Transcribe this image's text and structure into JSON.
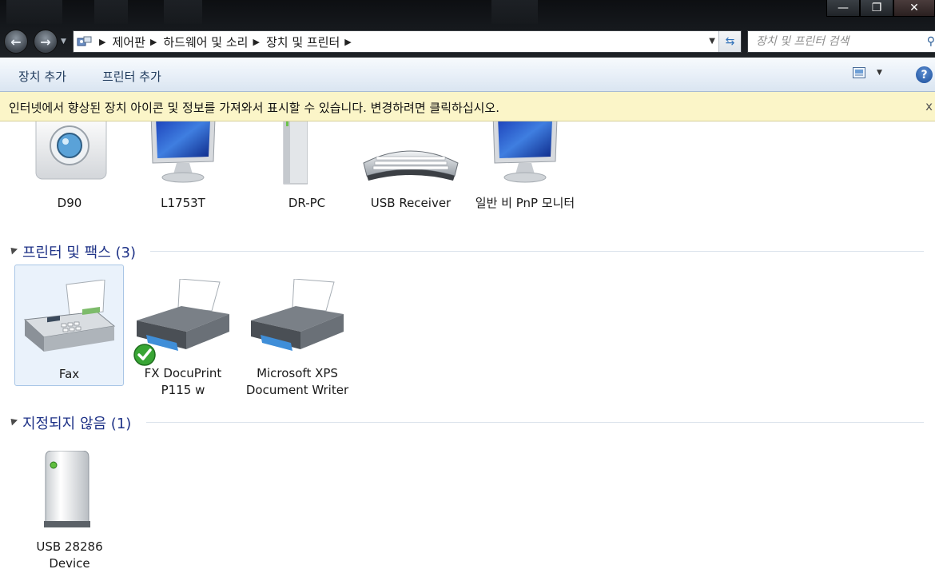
{
  "window": {
    "minimize_glyph": "—",
    "maximize_glyph": "❐",
    "close_glyph": "✕"
  },
  "address_bar": {
    "crumbs": [
      "제어판",
      "하드웨어 및 소리",
      "장치 및 프린터"
    ],
    "search_placeholder": "장치 및 프린터 검색"
  },
  "toolbar": {
    "add_device": "장치 추가",
    "add_printer": "프린터 추가"
  },
  "infobar": {
    "message": "인터넷에서 향상된 장치 아이콘 및 정보를 가져와서 표시할 수 있습니다. 변경하려면 클릭하십시오.",
    "close_glyph": "x"
  },
  "devices_row": [
    {
      "label": "D90",
      "icon": "camera-icon"
    },
    {
      "label": "L1753T",
      "icon": "monitor-icon"
    },
    {
      "label": "DR-PC",
      "visible_label": "DR-PC",
      "icon": "pc-tower-icon"
    },
    {
      "label": "USB Receiver",
      "icon": "keyboard-icon"
    },
    {
      "label": "일반 비 PnP 모니터",
      "icon": "monitor-icon"
    }
  ],
  "groups": {
    "printers": {
      "title": "프린터 및 팩스 (3)",
      "items": [
        {
          "label": "Fax",
          "icon": "fax-icon",
          "selected": true
        },
        {
          "label": "FX DocuPrint P115 w",
          "icon": "printer-icon",
          "default": true
        },
        {
          "label": "Microsoft XPS Document Writer",
          "icon": "printer-icon"
        }
      ]
    },
    "unspecified": {
      "title": "지정되지 않음 (1)",
      "items": [
        {
          "label": "USB 28286 Device",
          "icon": "usb-device-icon"
        }
      ]
    }
  },
  "colors": {
    "group_title": "#1e3287",
    "infobar_bg": "#fbf5c8",
    "cmdbar_text": "#1e395b"
  }
}
